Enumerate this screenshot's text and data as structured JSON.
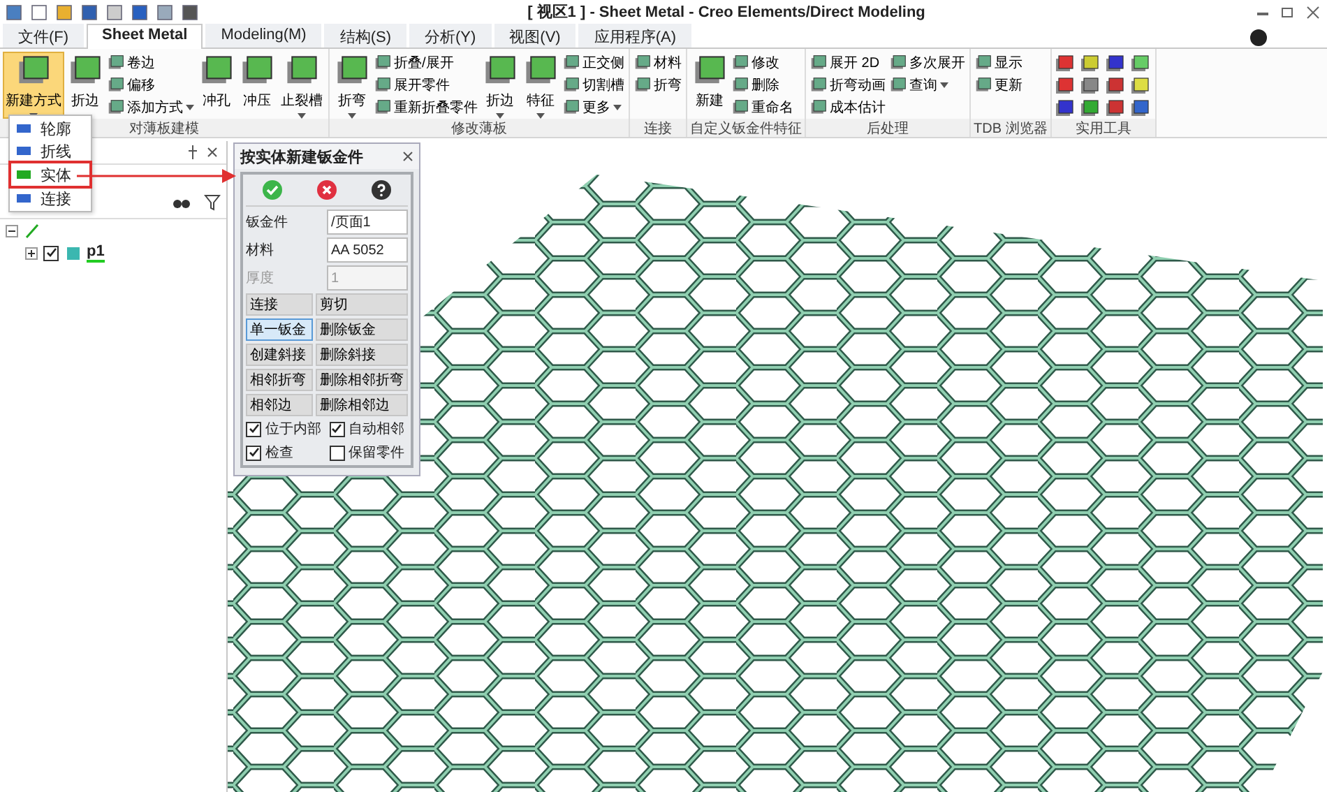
{
  "window": {
    "title": "[ 视区1 ] - Sheet Metal - Creo Elements/Direct Modeling"
  },
  "tabs": [
    {
      "label": "文件(F)",
      "selected": false
    },
    {
      "label": "Sheet Metal",
      "selected": true
    },
    {
      "label": "Modeling(M)",
      "selected": false
    },
    {
      "label": "结构(S)",
      "selected": false
    },
    {
      "label": "分析(Y)",
      "selected": false
    },
    {
      "label": "视图(V)",
      "selected": false
    },
    {
      "label": "应用程序(A)",
      "selected": false
    }
  ],
  "ribbon_groups": [
    {
      "label": "对薄板建模",
      "columns": [
        {
          "kind": "large",
          "label": "新建方式",
          "dropdown": true,
          "selected": true
        },
        {
          "kind": "large",
          "label": "折边",
          "dropdown": false,
          "selected": false
        },
        {
          "kind": "stack",
          "items": [
            {
              "label": "卷边",
              "dropdown": false
            },
            {
              "label": "偏移",
              "dropdown": false
            },
            {
              "label": "添加方式",
              "dropdown": true
            }
          ]
        },
        {
          "kind": "large",
          "label": "冲孔",
          "dropdown": false,
          "selected": false
        },
        {
          "kind": "large",
          "label": "冲压",
          "dropdown": false,
          "selected": false
        },
        {
          "kind": "large",
          "label": "止裂槽",
          "dropdown": true,
          "selected": false
        }
      ]
    },
    {
      "label": "修改薄板",
      "columns": [
        {
          "kind": "large",
          "label": "折弯",
          "dropdown": true,
          "selected": false
        },
        {
          "kind": "stack",
          "items": [
            {
              "label": "折叠/展开",
              "dropdown": false
            },
            {
              "label": "展开零件",
              "dropdown": false
            },
            {
              "label": "重新折叠零件",
              "dropdown": false
            }
          ]
        },
        {
          "kind": "large",
          "label": "折边",
          "dropdown": true,
          "selected": false
        },
        {
          "kind": "large",
          "label": "特征",
          "dropdown": true,
          "selected": false
        },
        {
          "kind": "stack",
          "items": [
            {
              "label": "正交侧",
              "dropdown": false
            },
            {
              "label": "切割槽",
              "dropdown": false
            },
            {
              "label": "更多",
              "dropdown": true
            }
          ]
        }
      ]
    },
    {
      "label": "连接",
      "columns": [
        {
          "kind": "stack",
          "items": [
            {
              "label": "材料",
              "dropdown": false
            },
            {
              "label": "折弯",
              "dropdown": false
            }
          ]
        }
      ]
    },
    {
      "label": "自定义钣金件特征",
      "columns": [
        {
          "kind": "large",
          "label": "新建",
          "dropdown": false,
          "selected": false
        },
        {
          "kind": "stack",
          "items": [
            {
              "label": "修改",
              "dropdown": false
            },
            {
              "label": "删除",
              "dropdown": false
            },
            {
              "label": "重命名",
              "dropdown": false
            }
          ]
        }
      ]
    },
    {
      "label": "后处理",
      "columns": [
        {
          "kind": "stack",
          "items": [
            {
              "label": "展开 2D",
              "dropdown": false
            },
            {
              "label": "折弯动画",
              "dropdown": false
            },
            {
              "label": "成本估计",
              "dropdown": false
            }
          ]
        },
        {
          "kind": "stack",
          "items": [
            {
              "label": "多次展开",
              "dropdown": false
            },
            {
              "label": "查询",
              "dropdown": true
            }
          ]
        }
      ]
    },
    {
      "label": "TDB 浏览器",
      "columns": [
        {
          "kind": "stack",
          "items": [
            {
              "label": "显示",
              "dropdown": false
            },
            {
              "label": "更新",
              "dropdown": false
            }
          ]
        }
      ]
    },
    {
      "label": "实用工具",
      "columns": [
        {
          "kind": "icons"
        }
      ]
    }
  ],
  "new_menu": {
    "items": [
      {
        "label": "轮廓",
        "selected": false
      },
      {
        "label": "折线",
        "selected": false
      },
      {
        "label": "实体",
        "selected": true
      },
      {
        "label": "连接",
        "selected": false
      }
    ]
  },
  "tree": {
    "items": [
      {
        "expanded": true,
        "children": [
          {
            "label": "p1",
            "expanded": false,
            "checked": true
          }
        ]
      }
    ]
  },
  "dialog": {
    "title": "按实体新建钣金件",
    "fields": [
      {
        "label": "钣金件",
        "value": "/页面1",
        "disabled": false
      },
      {
        "label": "材料",
        "value": "AA 5052",
        "disabled": false
      },
      {
        "label": "厚度",
        "value": "1",
        "disabled": true
      }
    ],
    "buttons": [
      {
        "label": "连接",
        "selected": false
      },
      {
        "label": "剪切",
        "selected": false
      },
      {
        "label": "单一钣金",
        "selected": true
      },
      {
        "label": "删除钣金",
        "selected": false
      },
      {
        "label": "创建斜接",
        "selected": false
      },
      {
        "label": "删除斜接",
        "selected": false
      },
      {
        "label": "相邻折弯",
        "selected": false
      },
      {
        "label": "删除相邻折弯",
        "selected": false
      },
      {
        "label": "相邻边",
        "selected": false
      },
      {
        "label": "删除相邻边",
        "selected": false
      }
    ],
    "options": [
      {
        "label": "位于内部",
        "checked": true
      },
      {
        "label": "自动相邻",
        "checked": true
      },
      {
        "label": "检查",
        "checked": true
      },
      {
        "label": "保留零件",
        "checked": false
      }
    ]
  }
}
